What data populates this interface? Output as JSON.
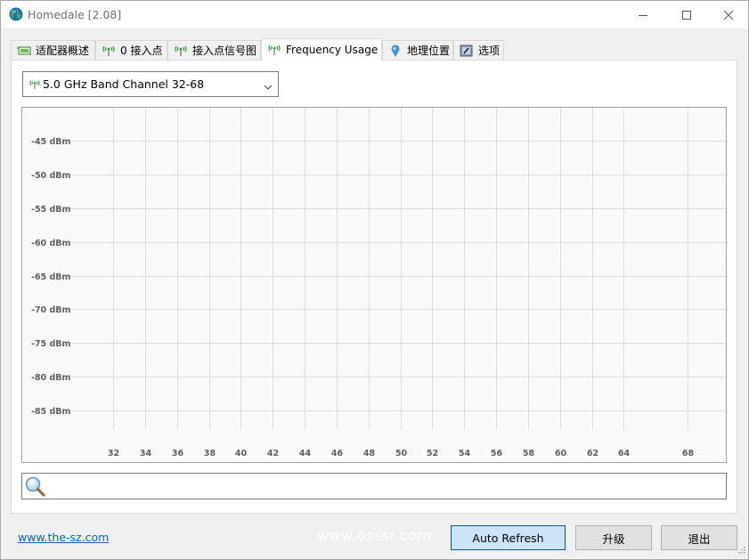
{
  "window": {
    "title": "Homedale [2.08]",
    "icon": "globe-icon",
    "controls": [
      "minimize-icon",
      "maximize-icon",
      "close-icon"
    ]
  },
  "tabs": [
    {
      "label": "适配器概述",
      "icon": "network-card-icon",
      "active": false
    },
    {
      "label": "0 接入点",
      "icon": "antenna-icon",
      "active": false
    },
    {
      "label": "接入点信号图",
      "icon": "antenna-icon",
      "active": false
    },
    {
      "label": "Frequency Usage",
      "icon": "antenna-icon",
      "active": true
    },
    {
      "label": "地理位置",
      "icon": "map-pin-icon",
      "active": false
    },
    {
      "label": "选项",
      "icon": "options-icon",
      "active": false
    }
  ],
  "band_select": {
    "value": "5.0 GHz Band Channel 32-68",
    "icon": "antenna-icon"
  },
  "chart_data": {
    "type": "line",
    "title": "",
    "xlabel": "",
    "ylabel": "",
    "x_ticks": [
      32,
      34,
      36,
      38,
      40,
      42,
      44,
      46,
      48,
      50,
      52,
      54,
      56,
      58,
      60,
      62,
      64,
      68
    ],
    "x_tick_labels": [
      "32",
      "34",
      "36",
      "38",
      "40",
      "42",
      "44",
      "46",
      "48",
      "50",
      "52",
      "54",
      "56",
      "58",
      "60",
      "62",
      "64",
      "68"
    ],
    "y_ticks": [
      -45,
      -50,
      -55,
      -60,
      -65,
      -70,
      -75,
      -80,
      -85
    ],
    "y_tick_labels": [
      "-45 dBm",
      "-50 dBm",
      "-55 dBm",
      "-60 dBm",
      "-65 dBm",
      "-70 dBm",
      "-75 dBm",
      "-80 dBm",
      "-85 dBm"
    ],
    "xlim": [
      32,
      68
    ],
    "ylim": [
      -90,
      -40
    ],
    "grid": true,
    "series": []
  },
  "search": {
    "value": "",
    "placeholder": "",
    "icon": "magnifier-icon"
  },
  "footer": {
    "link": "www.the-sz.com",
    "watermark": "www.osssr.com",
    "buttons": {
      "auto_refresh": "Auto Refresh",
      "upgrade": "升级",
      "exit": "退出"
    }
  }
}
